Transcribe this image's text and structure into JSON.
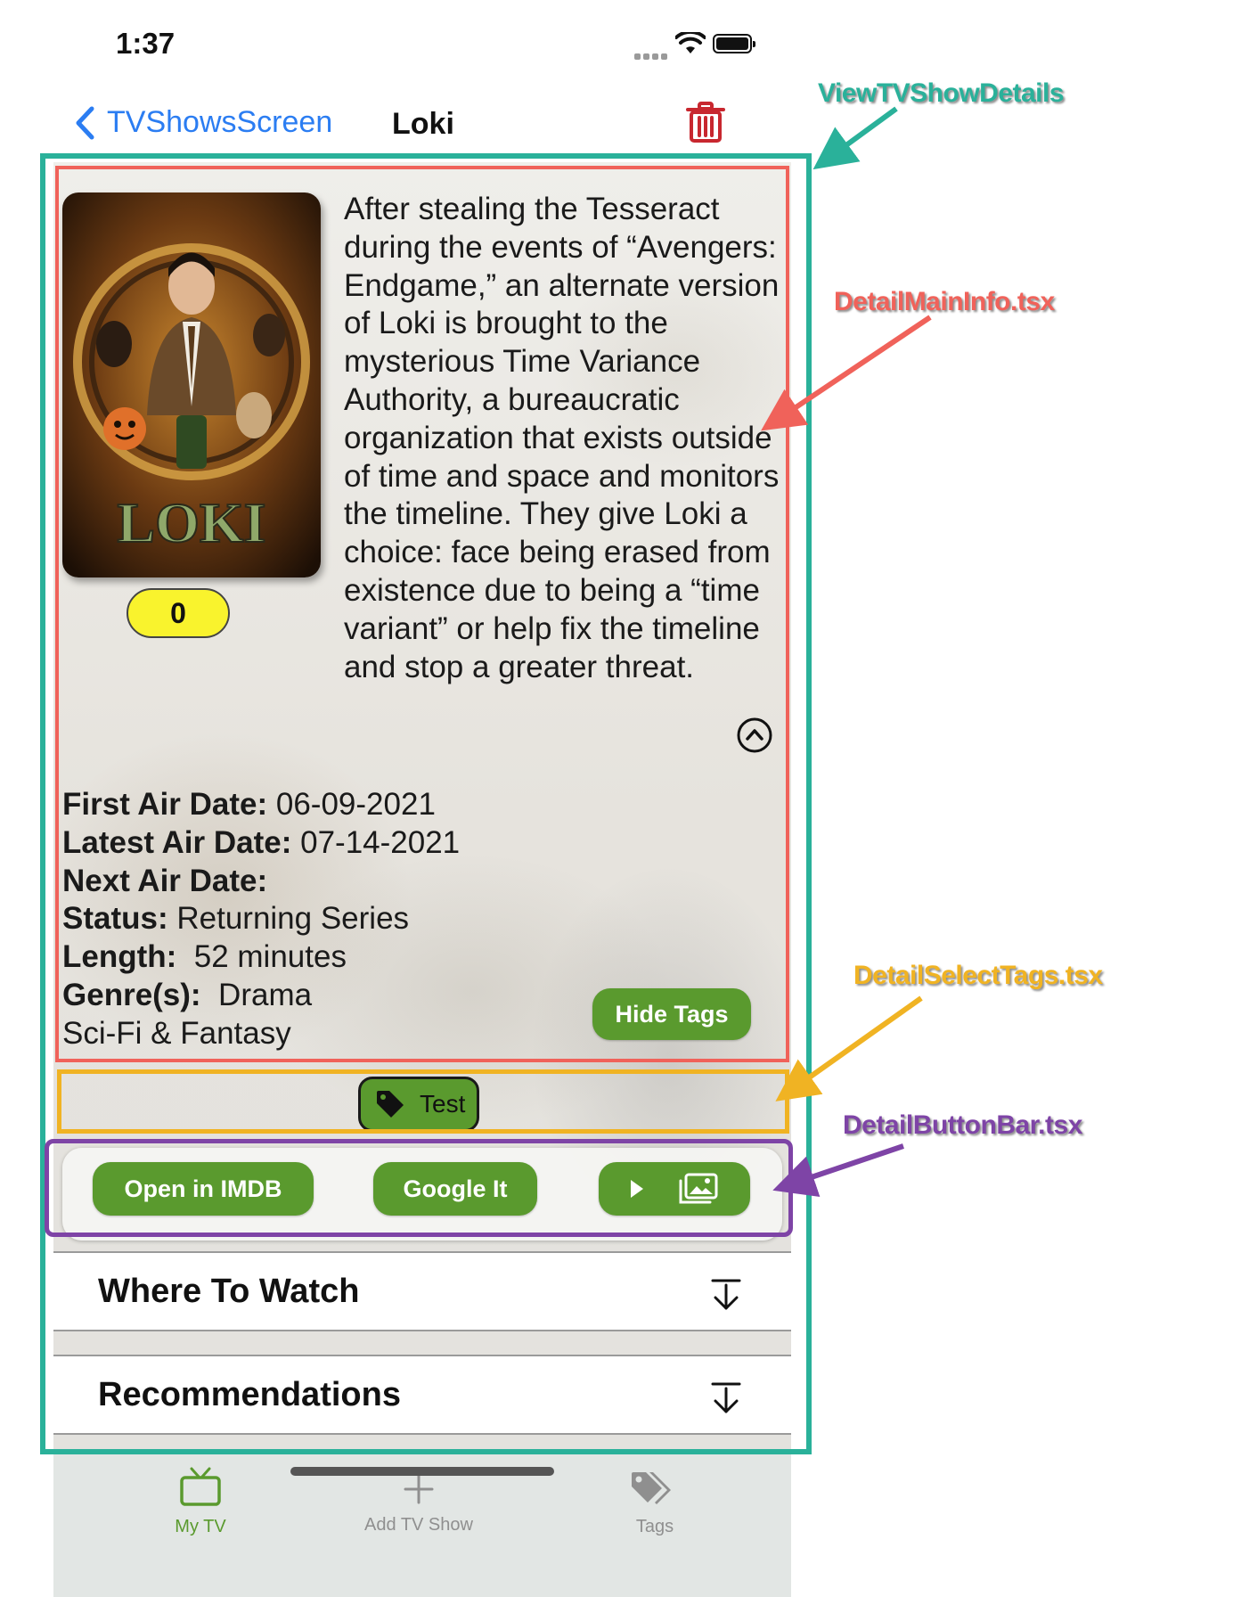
{
  "status_bar": {
    "time": "1:37"
  },
  "nav": {
    "back_label": "TVShowsScreen",
    "title": "Loki"
  },
  "show": {
    "rating": "0",
    "overview": "After stealing the Tesseract during the events of “Avengers: Endgame,” an alternate version of Loki is brought to the mysterious Time Variance Authority, a bureaucratic organization that exists outside of time and space and monitors the timeline. They give Loki a choice: face being erased from existence due to being a “time variant” or help fix the timeline and stop a greater threat.",
    "details": {
      "first_air_label": "First Air Date:",
      "first_air_value": "06-09-2021",
      "latest_air_label": "Latest Air Date:",
      "latest_air_value": "07-14-2021",
      "next_air_label": "Next Air Date:",
      "next_air_value": "",
      "status_label": "Status:",
      "status_value": "Returning Series",
      "length_label": "Length:",
      "length_value": "52 minutes",
      "genres_label": "Genre(s):",
      "genres": [
        "Drama",
        "Sci-Fi & Fantasy"
      ]
    },
    "poster_title": "LOKI"
  },
  "buttons": {
    "hide_tags": "Hide Tags",
    "open_imdb": "Open in IMDB",
    "google_it": "Google It"
  },
  "tags": [
    {
      "label": "Test"
    }
  ],
  "sections": {
    "where_to_watch": "Where To Watch",
    "recommendations": "Recommendations"
  },
  "tabbar": {
    "my_tv": "My TV",
    "add_tv_show": "Add TV Show",
    "tags": "Tags"
  },
  "annotations": {
    "view": "ViewTVShowDetails",
    "main_info": "DetailMainInfo.tsx",
    "select_tags": "DetailSelectTags.tsx",
    "button_bar": "DetailButtonBar.tsx"
  },
  "colors": {
    "accent_green": "#5a9a2e",
    "ios_blue": "#2b7df2",
    "trash_red": "#c8272f",
    "rating_yellow": "#f9f32d",
    "annotation_teal": "#2ab19a",
    "annotation_red": "#f0625a",
    "annotation_orange": "#f0b323",
    "annotation_purple": "#7e44a6"
  },
  "icons": {
    "back": "chevron-left-icon",
    "delete": "trash-icon",
    "collapse": "chevron-up-circle-icon",
    "tag": "tag-icon",
    "play": "play-icon",
    "images": "images-icon",
    "expand": "arrow-down-to-line-icon",
    "tab_my_tv": "tv-icon",
    "tab_add": "plus-icon",
    "tab_tags": "tags-icon"
  }
}
